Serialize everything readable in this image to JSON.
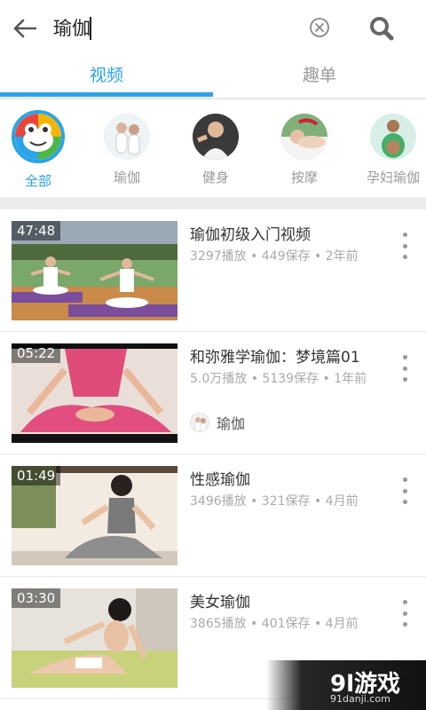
{
  "search": {
    "query": "瑜伽"
  },
  "tabs": [
    {
      "label": "视频",
      "active": true
    },
    {
      "label": "趣单",
      "active": false
    }
  ],
  "accent_color": "#2aa3e8",
  "categories": [
    {
      "label": "全部",
      "icon": "frog-mascot-icon",
      "selected": true
    },
    {
      "label": "瑜伽",
      "icon": "yoga-avatar",
      "selected": false
    },
    {
      "label": "健身",
      "icon": "fitness-avatar",
      "selected": false
    },
    {
      "label": "按摩",
      "icon": "massage-avatar",
      "selected": false
    },
    {
      "label": "孕妇瑜伽",
      "icon": "prenatal-yoga-avatar",
      "selected": false
    }
  ],
  "videos": [
    {
      "duration": "47:48",
      "title": "瑜伽初级入门视频",
      "meta": "3297播放 • 449保存 • 2年前",
      "uploader": null
    },
    {
      "duration": "05:22",
      "title": "和弥雅学瑜伽：梦境篇01",
      "meta": "5.0万播放 • 5139保存 • 1年前",
      "uploader": "瑜伽"
    },
    {
      "duration": "01:49",
      "title": "性感瑜伽",
      "meta": "3496播放 • 321保存 • 4月前",
      "uploader": null
    },
    {
      "duration": "03:30",
      "title": "美女瑜伽",
      "meta": "3865播放 • 401保存 • 4月前",
      "uploader": null
    }
  ],
  "watermark": {
    "logo": "9l游戏",
    "url": "91danji.com"
  }
}
